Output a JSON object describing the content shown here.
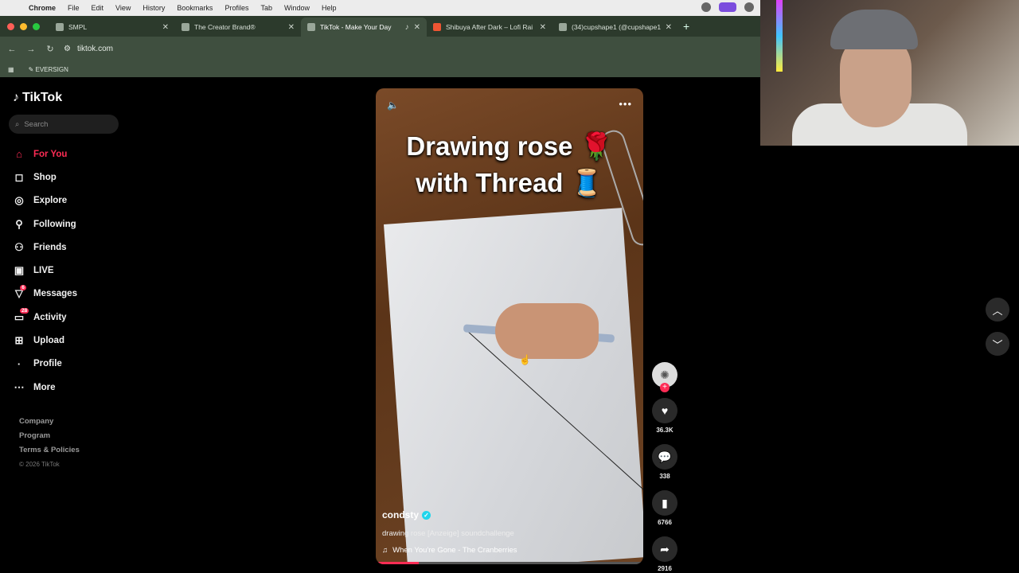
{
  "menubar": {
    "app": "Chrome",
    "items": [
      "File",
      "Edit",
      "View",
      "History",
      "Bookmarks",
      "Profiles",
      "Tab",
      "Window",
      "Help"
    ]
  },
  "tabs": [
    {
      "title": "SMPL",
      "icon": "sheet-icon",
      "active": false
    },
    {
      "title": "The Creator Brand®",
      "icon": "globe-icon",
      "active": false
    },
    {
      "title": "TikTok - Make Your Day",
      "icon": "tiktok-icon",
      "active": true
    },
    {
      "title": "Shibuya After Dark – Lofi Rai",
      "icon": "youtube-icon",
      "active": false
    },
    {
      "title": "(34)cupshape1 (@cupshape1",
      "icon": "tiktok-icon",
      "active": false
    }
  ],
  "address": {
    "url": "tiktok.com"
  },
  "bookmarks": {
    "items": [
      "EVERSIGN"
    ]
  },
  "tiktok": {
    "logo_text": "TikTok",
    "search_placeholder": "Search",
    "nav": [
      {
        "label": "For You",
        "icon": "home-icon",
        "active": true
      },
      {
        "label": "Shop",
        "icon": "bag-icon"
      },
      {
        "label": "Explore",
        "icon": "compass-icon"
      },
      {
        "label": "Following",
        "icon": "person-icon"
      },
      {
        "label": "Friends",
        "icon": "people-icon"
      },
      {
        "label": "LIVE",
        "icon": "tv-icon"
      },
      {
        "label": "Messages",
        "icon": "send-icon",
        "badge": "6"
      },
      {
        "label": "Activity",
        "icon": "inbox-icon",
        "badge": "28"
      },
      {
        "label": "Upload",
        "icon": "plus-square-icon"
      },
      {
        "label": "Profile",
        "icon": "avatar-icon"
      },
      {
        "label": "More",
        "icon": "more-icon"
      }
    ],
    "footer": {
      "links": [
        "Company",
        "Program",
        "Terms & Policies"
      ],
      "copyright": "© 2026 TikTok"
    }
  },
  "video": {
    "title_line1": "Drawing rose 🌹",
    "title_line2": "with Thread 🧵",
    "author": "condsty",
    "description": "drawing rose [Anzeige] soundchallenge",
    "song": "When You're Gone - The Cranberries",
    "progress": 0.16
  },
  "actions": {
    "likes": "36.3K",
    "comments": "338",
    "saves": "6766",
    "shares": "2916"
  }
}
